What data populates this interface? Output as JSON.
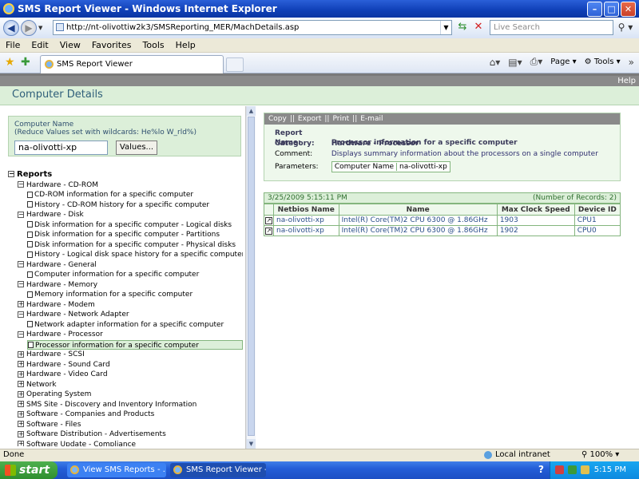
{
  "window": {
    "title": "SMS Report Viewer - Windows Internet Explorer"
  },
  "address": {
    "url": "http://nt-olivottiw2k3/SMSReporting_MER/MachDetails.asp",
    "search_placeholder": "Live Search"
  },
  "menu": [
    "File",
    "Edit",
    "View",
    "Favorites",
    "Tools",
    "Help"
  ],
  "tab": {
    "label": "SMS Report Viewer"
  },
  "toolbar": {
    "page": "Page",
    "tools": "Tools"
  },
  "app": {
    "help": "Help",
    "page_title": "Computer Details",
    "computer_name_label": "Computer Name",
    "computer_name_hint": "(Reduce Values set with wildcards: He%lo W_rld%)",
    "computer_name_value": "na-olivotti-xp",
    "values_button": "Values..."
  },
  "tree": {
    "root": "Reports",
    "nodes": [
      {
        "label": "Hardware - CD-ROM",
        "level": 1,
        "state": "-"
      },
      {
        "label": "CD-ROM information for a specific computer",
        "level": 2
      },
      {
        "label": "History - CD-ROM history for a specific computer",
        "level": 2
      },
      {
        "label": "Hardware - Disk",
        "level": 1,
        "state": "-"
      },
      {
        "label": "Disk information for a specific computer - Logical disks",
        "level": 2
      },
      {
        "label": "Disk information for a specific computer - Partitions",
        "level": 2
      },
      {
        "label": "Disk information for a specific computer - Physical disks",
        "level": 2
      },
      {
        "label": "History - Logical disk space history for a specific computer",
        "level": 2
      },
      {
        "label": "Hardware - General",
        "level": 1,
        "state": "-"
      },
      {
        "label": "Computer information for a specific computer",
        "level": 2
      },
      {
        "label": "Hardware - Memory",
        "level": 1,
        "state": "-"
      },
      {
        "label": "Memory information for a specific computer",
        "level": 2
      },
      {
        "label": "Hardware - Modem",
        "level": 1,
        "state": "+"
      },
      {
        "label": "Hardware - Network Adapter",
        "level": 1,
        "state": "-"
      },
      {
        "label": "Network adapter information for a specific computer",
        "level": 2
      },
      {
        "label": "Hardware - Processor",
        "level": 1,
        "state": "-"
      },
      {
        "label": "Processor information for a specific computer",
        "level": 2,
        "selected": true
      },
      {
        "label": "Hardware - SCSI",
        "level": 1,
        "state": "+"
      },
      {
        "label": "Hardware - Sound Card",
        "level": 1,
        "state": "+"
      },
      {
        "label": "Hardware - Video Card",
        "level": 1,
        "state": "+"
      },
      {
        "label": "Network",
        "level": 1,
        "state": "+"
      },
      {
        "label": "Operating System",
        "level": 1,
        "state": "+"
      },
      {
        "label": "SMS Site - Discovery and Inventory Information",
        "level": 1,
        "state": "+"
      },
      {
        "label": "Software - Companies and Products",
        "level": 1,
        "state": "+"
      },
      {
        "label": "Software - Files",
        "level": 1,
        "state": "+"
      },
      {
        "label": "Software Distribution - Advertisements",
        "level": 1,
        "state": "+"
      },
      {
        "label": "Software Update - Compliance",
        "level": 1,
        "state": "+"
      }
    ]
  },
  "report": {
    "actions": [
      "Copy",
      "||",
      "Export",
      "||",
      "Print",
      "||",
      "E-mail"
    ],
    "name_label": "Report Name:",
    "name": "Processor information for a specific computer",
    "category_label": "Category:",
    "category": "Hardware - Processor",
    "comment_label": "Comment:",
    "comment": "Displays summary information about the processors on a single computer",
    "parameters_label": "Parameters:",
    "param_name": "Computer Name",
    "param_value": "na-olivotti-xp"
  },
  "results": {
    "timestamp": "3/25/2009 5:15:11 PM",
    "count": "(Number of Records: 2)",
    "columns": [
      "Netbios Name",
      "Name",
      "Max Clock Speed",
      "Device ID"
    ],
    "rows": [
      [
        "na-olivotti-xp",
        "Intel(R) Core(TM)2 CPU        6300  @ 1.86GHz",
        "1903",
        "CPU1"
      ],
      [
        "na-olivotti-xp",
        "Intel(R) Core(TM)2 CPU        6300  @ 1.86GHz",
        "1902",
        "CPU0"
      ]
    ]
  },
  "status": {
    "left": "Done",
    "zone": "Local intranet",
    "zoom": "100%"
  },
  "taskbar": {
    "start": "start",
    "tasks": [
      "View SMS Reports - ...",
      "SMS Report Viewer - ..."
    ],
    "clock": "5:15 PM"
  }
}
